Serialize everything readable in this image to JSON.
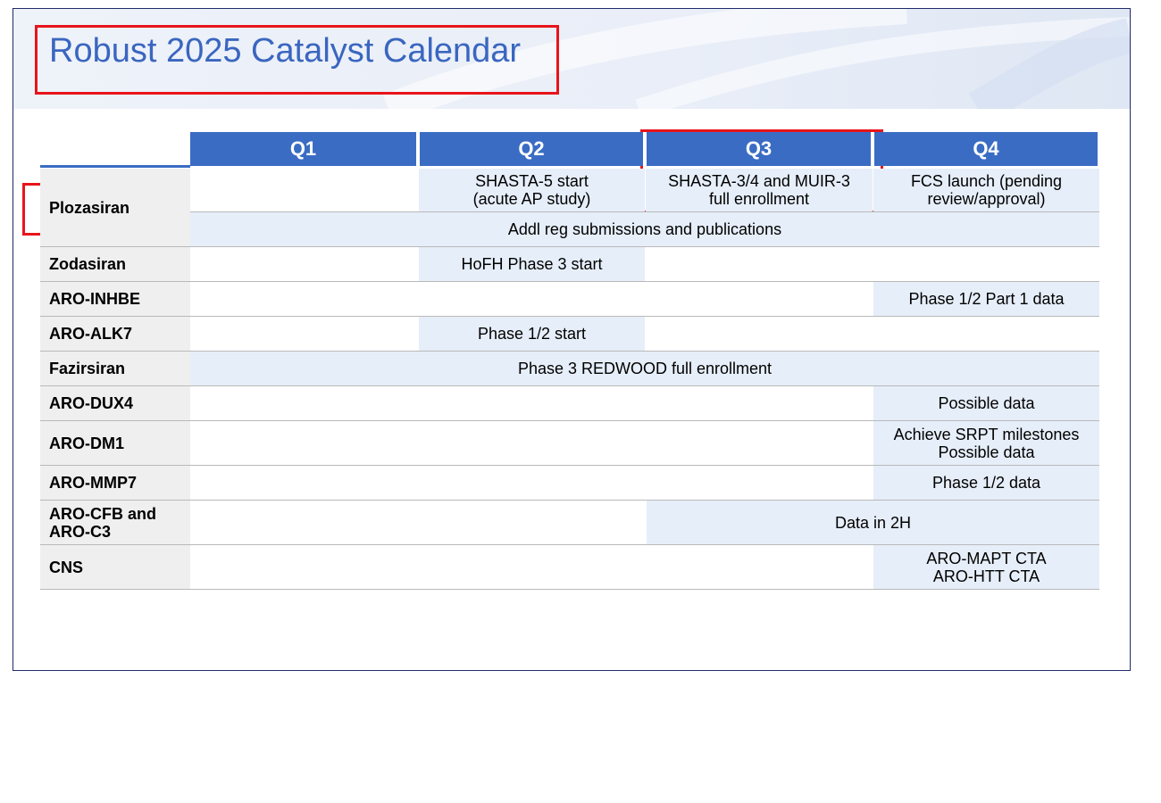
{
  "title": "Robust 2025 Catalyst Calendar",
  "colors": {
    "accent": "#3a66c0",
    "header": "#3a6cc4",
    "cell": "#e6eef9",
    "name_bg": "#efefef",
    "highlight": "#e8141b"
  },
  "quarters": [
    "Q1",
    "Q2",
    "Q3",
    "Q4"
  ],
  "rows": [
    {
      "name": "Plozasiran",
      "events": [
        {
          "text": "SHASTA-5 start\n(acute AP study)",
          "span": "Q2"
        },
        {
          "text": "SHASTA-3/4 and MUIR-3\nfull enrollment",
          "span": "Q3"
        },
        {
          "text": "FCS launch (pending\nreview/approval)",
          "span": "Q4"
        },
        {
          "text": "Addl reg submissions and publications",
          "span": "Q1-Q4"
        }
      ]
    },
    {
      "name": "Zodasiran",
      "events": [
        {
          "text": "HoFH Phase 3 start",
          "span": "Q2"
        }
      ]
    },
    {
      "name": "ARO-INHBE",
      "events": [
        {
          "text": "Phase 1/2 Part 1 data",
          "span": "Q4"
        }
      ]
    },
    {
      "name": "ARO-ALK7",
      "events": [
        {
          "text": "Phase 1/2 start",
          "span": "Q2"
        }
      ]
    },
    {
      "name": "Fazirsiran",
      "events": [
        {
          "text": "Phase 3 REDWOOD full enrollment",
          "span": "Q1-Q4"
        }
      ]
    },
    {
      "name": "ARO-DUX4",
      "events": [
        {
          "text": "Possible data",
          "span": "Q4"
        }
      ]
    },
    {
      "name": "ARO-DM1",
      "events": [
        {
          "text": "Achieve SRPT milestones\nPossible data",
          "span": "Q4"
        }
      ]
    },
    {
      "name": "ARO-MMP7",
      "events": [
        {
          "text": "Phase 1/2 data",
          "span": "Q4"
        }
      ]
    },
    {
      "name": "ARO-CFB and\nARO-C3",
      "events": [
        {
          "text": "Data in 2H",
          "span": "Q3-Q4"
        }
      ]
    },
    {
      "name": "CNS",
      "events": [
        {
          "text": "ARO-MAPT CTA\nARO-HTT CTA",
          "span": "Q4"
        }
      ]
    }
  ]
}
